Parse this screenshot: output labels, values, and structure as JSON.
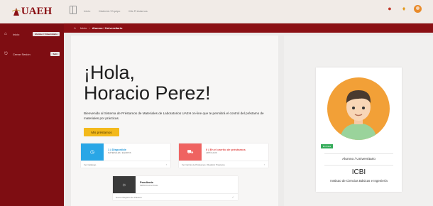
{
  "brand": {
    "logo_text": "UAEH"
  },
  "sidebar": {
    "items": [
      {
        "label": "Inicio",
        "badge": "Alumno / Universitario",
        "icon": "home-icon"
      },
      {
        "label": "Cerrar Sesión",
        "badge": "Salir",
        "icon": "logout-icon"
      }
    ]
  },
  "topbar": {
    "links": [
      "Inicio",
      "Material / Equipo",
      "Mis Préstamos"
    ],
    "icons": [
      "map-pin-icon",
      "flame-icon",
      "user-avatar-icon"
    ]
  },
  "breadcrumb": {
    "home": "Inicio",
    "current": "Alumno / Universitario"
  },
  "main": {
    "greeting": "¡Hola,",
    "name": "Horacio Perez!",
    "intro": "Bienvenido al Sistema de Préstamos de Materiales de Laboratorios UAEH on-line que te permitirá el control del préstamo de materiales por prácticas.",
    "primary_button": "Mis préstamos"
  },
  "cards": [
    {
      "title": "1 | Disponible",
      "subtitle": "MATERIALES / EQUIPOS",
      "footer": "Ver Catálogo",
      "icon": "clock-icon",
      "color": "#29a6e6"
    },
    {
      "title": "0 | En el carrito de préstamos",
      "subtitle": "ARTÍCULOS",
      "footer": "Ver Carrito de Préstamos / Realizar Préstamo",
      "icon": "cart-icon",
      "color": "#ef6361"
    },
    {
      "title": "Pendiente",
      "subtitle": "PRÁCTICA ACTUAL",
      "footer": "Nuevo Registro de Práctica",
      "icon": "bulb-icon",
      "color": "#3a3a3a"
    }
  ],
  "profile": {
    "status": "En línea",
    "role": "Alumno / Universitario",
    "institute": "ICBI",
    "institute_full": "Instituto de Ciencias Básicas e Ingeniería",
    "avatar_color": "#f2a037"
  },
  "colors": {
    "accent": "#7e0d12",
    "breadcrumb": "#8b1015",
    "button": "#f3b91b",
    "online": "#35ac5a"
  }
}
